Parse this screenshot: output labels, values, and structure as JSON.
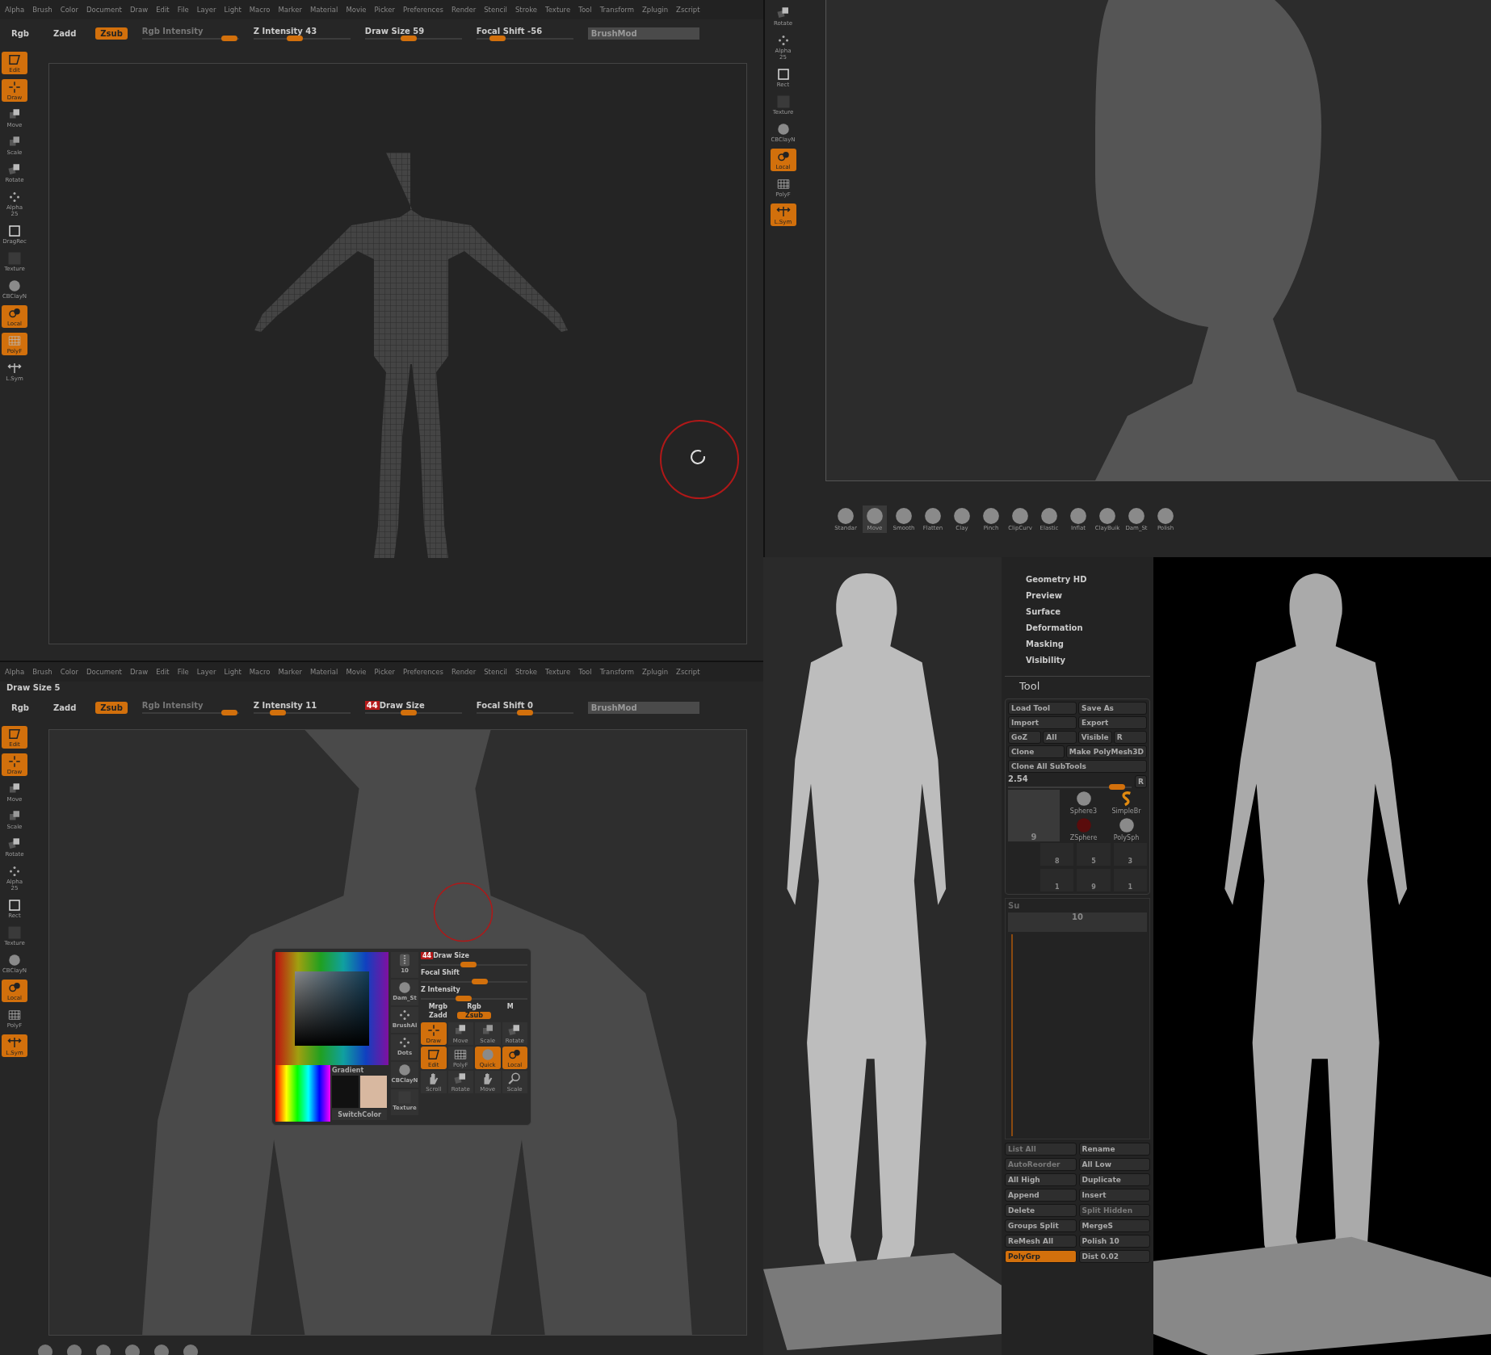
{
  "top_editor": {
    "menu": [
      "Alpha",
      "Brush",
      "Color",
      "Document",
      "Draw",
      "Edit",
      "File",
      "Layer",
      "Light",
      "Macro",
      "Marker",
      "Material",
      "Movie",
      "Picker",
      "Preferences",
      "Render",
      "Stencil",
      "Stroke",
      "Texture",
      "Tool",
      "Transform",
      "Zplugin",
      "Zscript"
    ],
    "toolbar": {
      "modes": [
        {
          "label": "Rgb",
          "selected": false
        },
        {
          "label": "Zadd",
          "selected": false
        },
        {
          "label": "Zsub",
          "selected": true
        }
      ],
      "rgb_intensity": {
        "label": "Rgb Intensity",
        "level": 0.9
      },
      "sliders": [
        {
          "label": "Z Intensity 43",
          "level": 0.43
        },
        {
          "label": "Draw Size 59",
          "level": 0.45
        },
        {
          "label": "Focal Shift -56",
          "level": 0.22
        }
      ],
      "brush_mod": "BrushMod"
    },
    "shelf": [
      {
        "label": "Edit",
        "kind": "edit",
        "on": true
      },
      {
        "label": "Draw",
        "kind": "draw",
        "on": true
      },
      {
        "label": "Move",
        "kind": "move",
        "on": false
      },
      {
        "label": "Scale",
        "kind": "scale",
        "on": false
      },
      {
        "label": "Rotate",
        "kind": "rotate",
        "on": false
      },
      {
        "label": "Alpha 25",
        "kind": "alpha",
        "on": false
      },
      {
        "label": "DragRec",
        "kind": "rect",
        "on": false
      },
      {
        "label": "Texture",
        "kind": "texture",
        "on": false
      },
      {
        "label": "CBClayN",
        "kind": "material",
        "on": false
      },
      {
        "label": "Local",
        "kind": "local",
        "on": true
      },
      {
        "label": "PolyF",
        "kind": "polyf",
        "on": true
      },
      {
        "label": "L.Sym",
        "kind": "lsym",
        "on": false
      }
    ]
  },
  "head_view": {
    "shelf": [
      {
        "label": "Rotate",
        "kind": "rotate",
        "on": false
      },
      {
        "label": "Alpha 25",
        "kind": "alpha",
        "on": false
      },
      {
        "label": "Rect",
        "kind": "rect",
        "on": false
      },
      {
        "label": "Texture",
        "kind": "texture",
        "on": false
      },
      {
        "label": "CBClayN",
        "kind": "material",
        "on": false
      },
      {
        "label": "Local",
        "kind": "local",
        "on": true
      },
      {
        "label": "PolyF",
        "kind": "polyf",
        "on": false
      },
      {
        "label": "L.Sym",
        "kind": "lsym",
        "on": true
      }
    ],
    "brushes": [
      {
        "label": "Standar",
        "selected": false
      },
      {
        "label": "Move",
        "selected": true
      },
      {
        "label": "Smooth",
        "selected": false
      },
      {
        "label": "Flatten",
        "selected": false
      },
      {
        "label": "Clay",
        "selected": false
      },
      {
        "label": "Pinch",
        "selected": false
      },
      {
        "label": "ClipCurv",
        "selected": false
      },
      {
        "label": "Elastic",
        "selected": false
      },
      {
        "label": "Inflat",
        "selected": false
      },
      {
        "label": "ClayBuik",
        "selected": false
      },
      {
        "label": "Dam_St",
        "selected": false
      },
      {
        "label": "Polish",
        "selected": false
      }
    ]
  },
  "bottom_editor": {
    "menu": [
      "Alpha",
      "Brush",
      "Color",
      "Document",
      "Draw",
      "Edit",
      "File",
      "Layer",
      "Light",
      "Macro",
      "Marker",
      "Material",
      "Movie",
      "Picker",
      "Preferences",
      "Render",
      "Stencil",
      "Stroke",
      "Texture",
      "Tool",
      "Transform",
      "Zplugin",
      "Zscript"
    ],
    "info": "Draw Size  5",
    "toolbar": {
      "modes": [
        {
          "label": "Rgb",
          "selected": false
        },
        {
          "label": "Zadd",
          "selected": false
        },
        {
          "label": "Zsub",
          "selected": true
        }
      ],
      "rgb_intensity": {
        "label": "Rgb Intensity",
        "level": 0.9
      },
      "sliders": [
        {
          "label": "Z Intensity 11",
          "level": 0.25
        },
        {
          "badge": "44",
          "label": "Draw Size",
          "level": 0.45
        },
        {
          "label": "Focal Shift 0",
          "level": 0.5
        }
      ],
      "brush_mod": "BrushMod"
    },
    "shelf": [
      {
        "label": "Edit",
        "kind": "edit",
        "on": true
      },
      {
        "label": "Draw",
        "kind": "draw",
        "on": true
      },
      {
        "label": "Move",
        "kind": "move",
        "on": false
      },
      {
        "label": "Scale",
        "kind": "scale",
        "on": false
      },
      {
        "label": "Rotate",
        "kind": "rotate",
        "on": false
      },
      {
        "label": "Alpha 25",
        "kind": "alpha",
        "on": false
      },
      {
        "label": "Rect",
        "kind": "rect",
        "on": false
      },
      {
        "label": "Texture",
        "kind": "texture",
        "on": false
      },
      {
        "label": "CBClayN",
        "kind": "material",
        "on": false
      },
      {
        "label": "Local",
        "kind": "local",
        "on": true
      },
      {
        "label": "PolyF",
        "kind": "polyf",
        "on": false
      },
      {
        "label": "L.Sym",
        "kind": "lsym",
        "on": true
      }
    ],
    "popup": {
      "gradient": "Gradient",
      "switch_color": "SwitchColor",
      "brushes": [
        {
          "label": "10",
          "kind": "stroke"
        },
        {
          "label": "Dam_St",
          "kind": "material"
        },
        {
          "label": "BrushAl",
          "kind": "alpha"
        },
        {
          "label": "Dots",
          "kind": "dots"
        },
        {
          "label": "CBClayN",
          "kind": "material"
        },
        {
          "label": "Texture",
          "kind": "texture"
        }
      ],
      "sliders": [
        {
          "badge": "44",
          "label": "Draw Size",
          "level": 0.45
        },
        {
          "label": "Focal Shift",
          "level": 0.55
        },
        {
          "label": "Z Intensity",
          "level": 0.4
        }
      ],
      "modes": [
        {
          "label": "Mrgb",
          "selected": false
        },
        {
          "label": "Rgb",
          "selected": false
        },
        {
          "label": "M",
          "selected": false
        },
        {
          "label": "Zadd",
          "selected": false
        },
        {
          "label": "Zsub",
          "selected": true
        }
      ],
      "buttons": [
        {
          "label": "Draw",
          "kind": "draw",
          "on": true
        },
        {
          "label": "Move",
          "kind": "move",
          "on": false
        },
        {
          "label": "Scale",
          "kind": "scale",
          "on": false
        },
        {
          "label": "Rotate",
          "kind": "rotate",
          "on": false
        },
        {
          "label": "Edit",
          "kind": "edit",
          "on": true
        },
        {
          "label": "PolyF",
          "kind": "polyf",
          "on": false
        },
        {
          "label": "Quick",
          "kind": "material",
          "on": true
        },
        {
          "label": "Local",
          "kind": "local",
          "on": true
        },
        {
          "label": "Scroll",
          "kind": "scroll",
          "on": false
        },
        {
          "label": "Rotate",
          "kind": "rotate",
          "on": false
        },
        {
          "label": "Move",
          "kind": "scroll",
          "on": false
        },
        {
          "label": "Scale",
          "kind": "zoom",
          "on": false
        }
      ]
    }
  },
  "tool_panel": {
    "sections": [
      "Geometry HD",
      "Preview",
      "Surface",
      "Deformation",
      "Masking",
      "Visibility"
    ],
    "title": "Tool",
    "top_buttons": [
      [
        {
          "label": "Load Tool"
        },
        {
          "label": "Save As"
        }
      ],
      [
        {
          "label": "Import"
        },
        {
          "label": "Export"
        }
      ],
      [
        {
          "label": "GoZ"
        },
        {
          "label": "All"
        },
        {
          "label": "Visible"
        },
        {
          "label": "R"
        }
      ],
      [
        {
          "label": "Clone"
        },
        {
          "label": "Make PolyMesh3D"
        }
      ],
      [
        {
          "label": "Clone All SubTools"
        }
      ]
    ],
    "scale": {
      "value": "2.54",
      "level": 0.88,
      "reset": "R"
    },
    "current_tool": "9",
    "tools": [
      {
        "label": "Sphere3",
        "kind": "sphere"
      },
      {
        "label": "SimpleBr",
        "kind": "s"
      },
      {
        "label": "ZSphere",
        "kind": "zsphere"
      },
      {
        "label": "PolySph",
        "kind": "polysphere"
      }
    ],
    "recent": [
      "8",
      "5",
      "3",
      "1",
      "9",
      "1"
    ],
    "subtool_header": "Su",
    "subtool_level": "10",
    "bottom_buttons": [
      {
        "label": "List All",
        "disabled": true,
        "on": false
      },
      {
        "label": "Rename",
        "disabled": false,
        "on": false
      },
      {
        "label": "AutoReorder",
        "disabled": true,
        "on": false
      },
      {
        "label": "All Low",
        "disabled": false,
        "on": false
      },
      {
        "label": "All High",
        "disabled": false,
        "on": false
      },
      {
        "label": "Duplicate",
        "disabled": false,
        "on": false
      },
      {
        "label": "Append",
        "disabled": false,
        "on": false
      },
      {
        "label": "Insert",
        "disabled": false,
        "on": false
      },
      {
        "label": "Delete",
        "disabled": false,
        "on": false
      },
      {
        "label": "Split Hidden",
        "disabled": true,
        "on": false
      },
      {
        "label": "Groups Split",
        "disabled": false,
        "on": false
      },
      {
        "label": "MergeS",
        "disabled": false,
        "on": false
      },
      {
        "label": "ReMesh All",
        "disabled": false,
        "on": false
      },
      {
        "label": "Polish 10",
        "disabled": false,
        "on": false
      },
      {
        "label": "PolyGrp",
        "disabled": false,
        "on": true
      },
      {
        "label": "Dist 0.02",
        "disabled": false,
        "on": false
      }
    ]
  }
}
